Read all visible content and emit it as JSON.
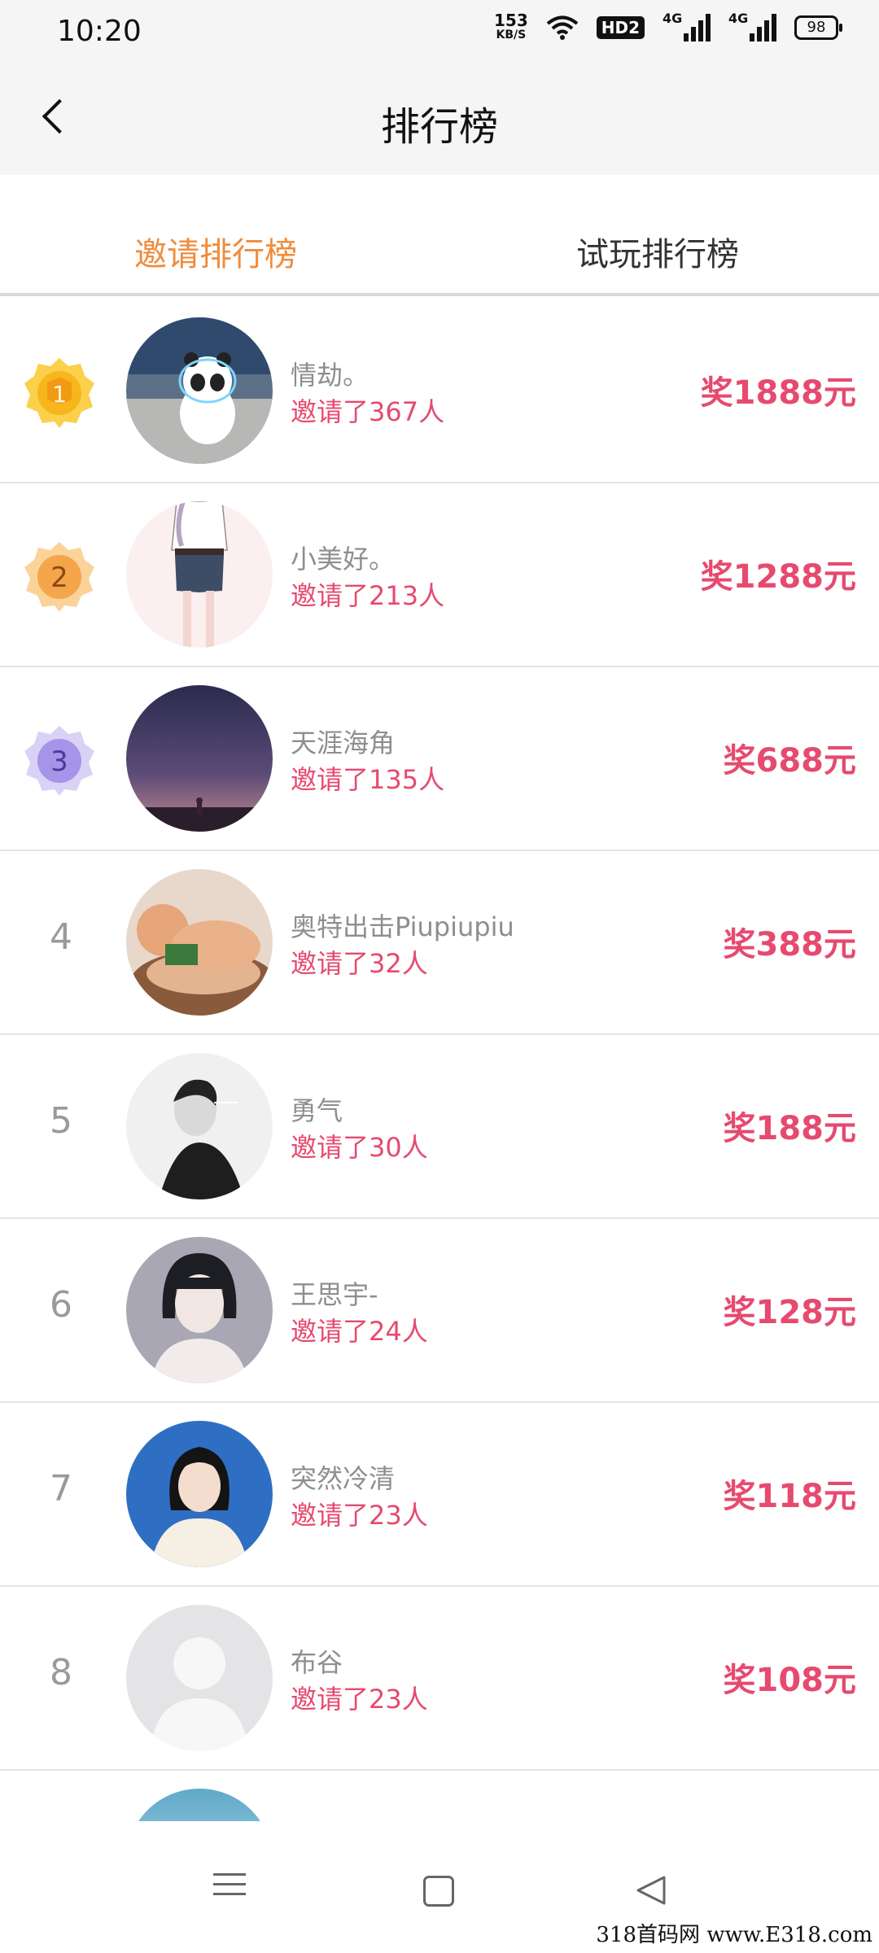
{
  "status_bar": {
    "time": "10:20",
    "net_speed": "153",
    "net_unit": "KB/S",
    "hd_badge": "HD2",
    "signal1_label": "4G",
    "signal2_label": "4G",
    "battery": "98",
    "icons": [
      "wifi-icon",
      "signal-icon",
      "signal-icon",
      "battery-icon"
    ]
  },
  "header": {
    "title": "排行榜",
    "back_icon": "chevron-left-icon"
  },
  "tabs": [
    {
      "label": "邀请排行榜",
      "active": true,
      "color": "#f08c3c"
    },
    {
      "label": "试玩排行榜",
      "active": false
    }
  ],
  "colors": {
    "accent": "#e64a6f",
    "tab_active": "#f08c3c",
    "gold": "#f7b61c",
    "orange": "#f5a54a",
    "purple": "#a594e8"
  },
  "rankings": [
    {
      "rank": "1",
      "name": "情劫。",
      "invited": "邀请了367人",
      "prize": "奖1888元"
    },
    {
      "rank": "2",
      "name": "小美好。",
      "invited": "邀请了213人",
      "prize": "奖1288元"
    },
    {
      "rank": "3",
      "name": "天涯海角",
      "invited": "邀请了135人",
      "prize": "奖688元"
    },
    {
      "rank": "4",
      "name": "奥特出击Piupiupiu",
      "invited": "邀请了32人",
      "prize": "奖388元"
    },
    {
      "rank": "5",
      "name": "勇气",
      "invited": "邀请了30人",
      "prize": "奖188元"
    },
    {
      "rank": "6",
      "name": "王思宇-",
      "invited": "邀请了24人",
      "prize": "奖128元"
    },
    {
      "rank": "7",
      "name": "突然冷清",
      "invited": "邀请了23人",
      "prize": "奖118元"
    },
    {
      "rank": "8",
      "name": "布谷",
      "invited": "邀请了23人",
      "prize": "奖108元"
    }
  ],
  "nav": {
    "icons": [
      "menu-icon",
      "home-icon",
      "back-triangle-icon"
    ]
  },
  "watermark": "318首码网 www.E318.com"
}
